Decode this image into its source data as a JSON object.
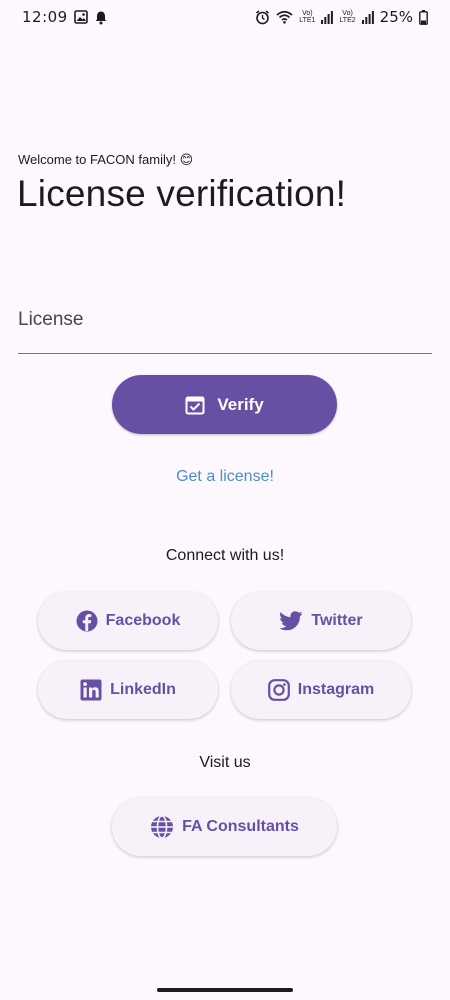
{
  "status_bar": {
    "time": "12:09",
    "volte1": "Vo)",
    "lte1": "LTE1",
    "volte2": "Vo)",
    "lte2": "LTE2",
    "battery": "25%"
  },
  "header": {
    "welcome": "Welcome to FACON family! 😊",
    "title": "License verification!"
  },
  "license_field": {
    "placeholder": "License",
    "value": ""
  },
  "verify_button": {
    "label": "Verify"
  },
  "get_license_link": {
    "label": "Get a license!"
  },
  "connect": {
    "heading": "Connect with us!",
    "buttons": [
      {
        "label": "Facebook",
        "icon": "facebook-icon"
      },
      {
        "label": "Twitter",
        "icon": "twitter-icon"
      },
      {
        "label": "LinkedIn",
        "icon": "linkedin-icon"
      },
      {
        "label": "Instagram",
        "icon": "instagram-icon"
      }
    ]
  },
  "visit": {
    "heading": "Visit us",
    "button": {
      "label": "FA Consultants",
      "icon": "globe-icon"
    }
  },
  "colors": {
    "primary": "#6750A4",
    "background": "#FDF7FE",
    "link": "#4A8FC8",
    "tonal_button": "#F7F2FA"
  }
}
